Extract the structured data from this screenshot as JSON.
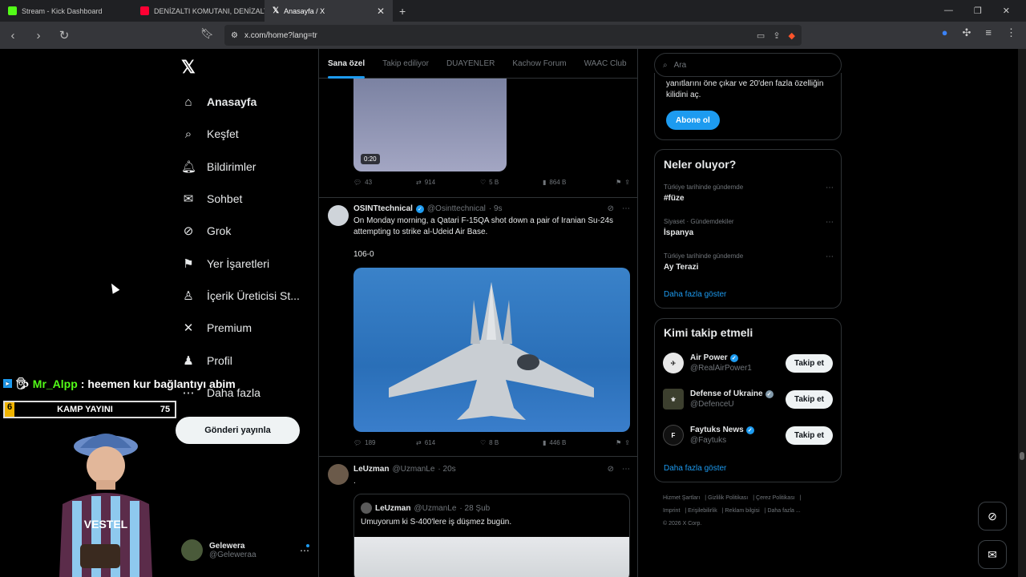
{
  "browser": {
    "tabs": [
      {
        "label": "Stream - Kick Dashboard",
        "color": "#53fc18"
      },
      {
        "label": "DENİZALTI KOMUTANI, DENİZALTI SA",
        "color": "#ff0033"
      },
      {
        "label": "Anasayfa / X",
        "color": "#ffffff"
      }
    ],
    "url": "x.com/home?lang=tr"
  },
  "nav": {
    "items": [
      {
        "label": "Anasayfa",
        "icon": "home-icon"
      },
      {
        "label": "Keşfet",
        "icon": "search-icon"
      },
      {
        "label": "Bildirimler",
        "icon": "bell-icon"
      },
      {
        "label": "Sohbet",
        "icon": "mail-icon"
      },
      {
        "label": "Grok",
        "icon": "grok-icon"
      },
      {
        "label": "Yer İşaretleri",
        "icon": "bookmark-icon"
      },
      {
        "label": "İçerik Üreticisi St...",
        "icon": "creator-icon"
      },
      {
        "label": "Premium",
        "icon": "x-icon"
      },
      {
        "label": "Profil",
        "icon": "person-icon"
      },
      {
        "label": "Daha fazla",
        "icon": "more-icon"
      }
    ],
    "post_button": "Gönderi yayınla",
    "account": {
      "name": "Gelewera",
      "handle": "@Geleweraa"
    }
  },
  "overlay": {
    "chat_user": "Mr_Alpp",
    "chat_message": ": heemen kur bağlantıyı abim",
    "kamp_left": "6",
    "kamp_label": "KAMP YAYINI",
    "kamp_right": "75"
  },
  "feed": {
    "tabs": [
      "Sana özel",
      "Takip ediliyor",
      "DUAYENLER",
      "Kachow Forum",
      "WAAC Club"
    ],
    "post1": {
      "video_time": "0:20",
      "replies": "43",
      "reposts": "914",
      "likes": "5 B",
      "views": "864 B"
    },
    "post2": {
      "name": "OSINTtechnical",
      "handle": "@Osinttechnical",
      "time": "· 9s",
      "text": "On Monday morning, a Qatari F-15QA shot down a pair of Iranian Su-24s attempting to strike al-Udeid Air Base.",
      "text2": "106-0",
      "replies": "189",
      "reposts": "614",
      "likes": "8 B",
      "views": "446 B"
    },
    "post3": {
      "name": "LeUzman",
      "handle": "@UzmanLe",
      "time": "· 20s",
      "text": ".",
      "quote_name": "LeUzman",
      "quote_handle": "@UzmanLe",
      "quote_time": "· 28 Şub",
      "quote_text": "Umuyorum ki S-400'lere iş düşmez bugün."
    }
  },
  "right": {
    "search_placeholder": "Ara",
    "premium_text": "yanıtlarını öne çıkar ve 20'den fazla özelliğin kilidini aç.",
    "subscribe": "Abone ol",
    "trends_title": "Neler oluyor?",
    "trends": [
      {
        "context": "Türkiye tarihinde gündemde",
        "name": "#füze"
      },
      {
        "context": "Siyaset · Gündemdekiler",
        "name": "İspanya"
      },
      {
        "context": "Türkiye tarihinde gündemde",
        "name": "Ay Terazi"
      }
    ],
    "show_more": "Daha fazla göster",
    "follow_title": "Kimi takip etmeli",
    "follow": [
      {
        "name": "Air Power",
        "handle": "@RealAirPower1",
        "button": "Takip et"
      },
      {
        "name": "Defense of Ukraine",
        "handle": "@DefenceU",
        "button": "Takip et"
      },
      {
        "name": "Faytuks News",
        "handle": "@Faytuks",
        "button": "Takip et"
      }
    ],
    "footer": [
      "Hizmet Şartları",
      "Gizlilik Politikası",
      "Çerez Politikası",
      "Imprint",
      "Erişilebilirlik",
      "Reklam bilgisi",
      "Daha fazla ...",
      "© 2026 X Corp."
    ]
  },
  "colors": {
    "accent": "#1d9bf0",
    "kick_green": "#53fc18"
  }
}
